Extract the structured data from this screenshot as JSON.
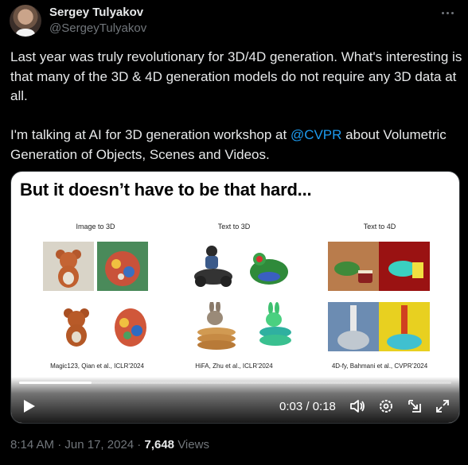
{
  "author": {
    "display_name": "Sergey Tulyakov",
    "handle": "@SergeyTulyakov"
  },
  "tweet": {
    "text_part1": "Last year was truly revolutionary for 3D/4D generation. What's interesting is that many of the 3D & 4D generation models do not require any 3D data at all.\n\nI'm talking at AI for 3D generation workshop at ",
    "mention": "@CVPR",
    "text_part2": " about Volumetric Generation of Objects, Scenes and Videos."
  },
  "media": {
    "slide_title": "But it doesn’t have to be that hard...",
    "columns": [
      {
        "heading": "Image to 3D",
        "citation": "Magic123, Qian et al., ICLR’2024"
      },
      {
        "heading": "Text to 3D",
        "citation": "HiFA, Zhu et al., ICLR’2024"
      },
      {
        "heading": "Text to 4D",
        "citation": "4D-fy, Bahmani et al., CVPR’2024"
      }
    ],
    "player": {
      "time": "0:03 / 0:18",
      "progress": 0.167,
      "icons": [
        "play-icon",
        "volume-icon",
        "settings-icon",
        "dock-icon",
        "fullscreen-icon"
      ]
    }
  },
  "meta": {
    "time": "8:14 AM",
    "date": "Jun 17, 2024",
    "separator": " · ",
    "views_count": "7,648",
    "views_label": " Views"
  },
  "colors": {
    "background": "#000000",
    "text": "#e7e9ea",
    "muted": "#71767b",
    "link": "#1d9bf0"
  }
}
